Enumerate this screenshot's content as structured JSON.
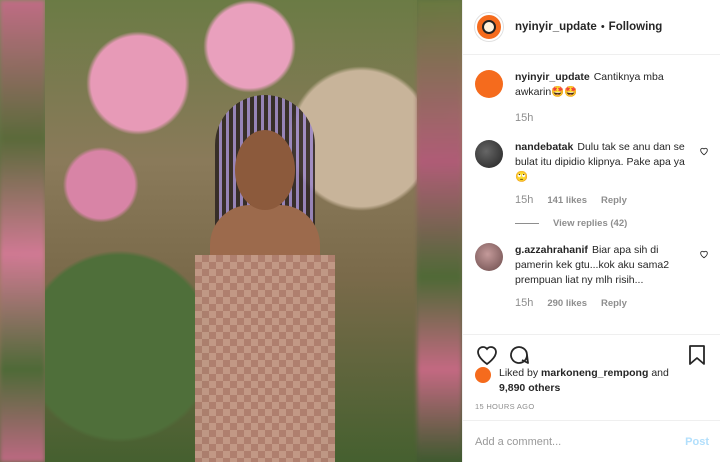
{
  "post": {
    "username": "nyinyir_update",
    "separator": "•",
    "follow_label": "Following"
  },
  "caption": {
    "username": "nyinyir_update",
    "text": "Cantiknya mba awkarin🤩🤩",
    "time": "15h"
  },
  "comments": [
    {
      "username": "nandebatak",
      "text": "Dulu tak se anu dan se bulat itu dipidio klipnya. Pake apa ya 🙄",
      "time": "15h",
      "likes": "141 likes",
      "reply": "Reply",
      "view_replies": "View replies (42)"
    },
    {
      "username": "g.azzahrahanif",
      "text": "Biar apa sih di pamerin kek gtu...kok aku sama2 prempuan liat ny mlh risih...",
      "time": "15h",
      "likes": "290 likes",
      "reply": "Reply"
    }
  ],
  "likes": {
    "prefix": "Liked by",
    "user": "markoneng_rempong",
    "connector": "and",
    "others": "9,890 others"
  },
  "timestamp": "15 HOURS AGO",
  "add_comment": {
    "placeholder": "Add a comment...",
    "post_label": "Post"
  },
  "icons": [
    "heart-icon",
    "comment-icon",
    "bookmark-icon"
  ],
  "colors": {
    "avatar": "#f56b1d",
    "post_disabled": "#b2dffc",
    "muted": "#8e8e8e"
  }
}
